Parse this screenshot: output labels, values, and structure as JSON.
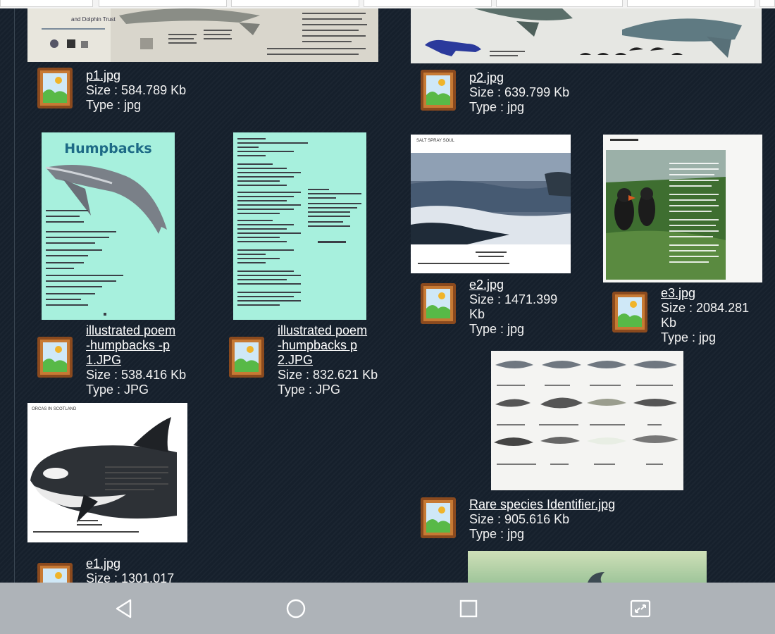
{
  "files": [
    {
      "name": "p1.jpg",
      "size": "Size : 584.789 Kb",
      "type": "Type : jpg"
    },
    {
      "name": "p2.jpg",
      "size": "Size : 639.799 Kb",
      "type": "Type : jpg"
    },
    {
      "name_lines": [
        "illustrated poem",
        "-humpbacks -p",
        "1.JPG"
      ],
      "size": "Size : 538.416 Kb",
      "type": "Type : JPG"
    },
    {
      "name_lines": [
        "illustrated poem",
        "-humpbacks p",
        "2.JPG"
      ],
      "size": "Size : 832.621 Kb",
      "type": "Type : JPG"
    },
    {
      "name": "e2.jpg",
      "size_lines": [
        "Size : 1471.399",
        "Kb"
      ],
      "type": "Type : jpg"
    },
    {
      "name": "e3.jpg",
      "size_lines": [
        "Size : 2084.281",
        "Kb"
      ],
      "type": "Type : jpg"
    },
    {
      "name": "Rare species Identifier.jpg",
      "size": "Size : 905.616 Kb",
      "type": "Type : jpg"
    },
    {
      "name": "e1.jpg",
      "size": "Size : 1301.017"
    }
  ],
  "thumb_text": {
    "humpbacks_title": "Humpbacks",
    "salt_spray": "SALT SPRAY SOUL",
    "orcas": "ORCAS IN SCOTLAND"
  },
  "colors": {
    "background": "#16202c",
    "navbar": "#aeb3b8",
    "poem_bg": "#a7f0dd"
  },
  "navbar": {
    "icons": [
      "back-icon",
      "home-icon",
      "recents-icon",
      "screen-resize-icon"
    ]
  }
}
